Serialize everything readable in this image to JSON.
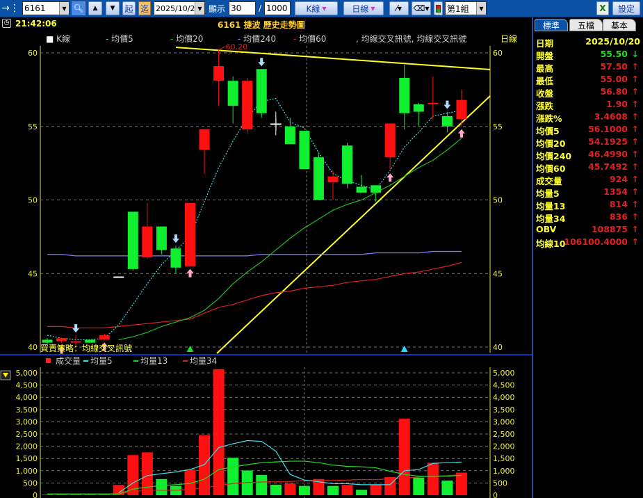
{
  "toolbar": {
    "symbol": "6161",
    "start_label": "起",
    "end_label": "迄",
    "date": "2025/10/20",
    "display_label": "顯示",
    "display_count": "30",
    "slash": "/",
    "total_count": "1000",
    "chart_type": "K線",
    "period": "日線",
    "group": "第1組",
    "settings_label": "設定"
  },
  "header": {
    "time": "21:42:06",
    "title": "6161 捷波  歷史走勢圖"
  },
  "legend": {
    "items": [
      {
        "label": "K線",
        "color": "#ffffff",
        "marker": "■"
      },
      {
        "label": "均價5",
        "color": "#44dddd",
        "marker": "-"
      },
      {
        "label": "均價20",
        "color": "#22cc22",
        "marker": "-"
      },
      {
        "label": "均價240",
        "color": "#8888ff",
        "marker": "-"
      },
      {
        "label": "均價60",
        "color": "#dd2222",
        "marker": "-"
      }
    ],
    "signal": ", 均線交叉訊號, 均線交叉訊號",
    "period": "日線"
  },
  "strategy_label": "買賣策略：均線交叉訊號",
  "high_marker": "60.20",
  "volume_legend": [
    {
      "label": "成交量",
      "color": "#ff2020",
      "marker": "■"
    },
    {
      "label": "均量5",
      "color": "#44ddee",
      "marker": "-"
    },
    {
      "label": "均量13",
      "color": "#22dd22",
      "marker": "-"
    },
    {
      "label": "均量34",
      "color": "#dd2222",
      "marker": "-"
    }
  ],
  "right_panel": {
    "tabs": [
      "標準",
      "五檔",
      "基本"
    ],
    "rows": [
      {
        "k": "日期",
        "v": "2025/10/20",
        "color": "#ffff33",
        "arrow": ""
      },
      {
        "k": "開盤",
        "v": "55.50",
        "color": "#22dd22",
        "arrow": "↓"
      },
      {
        "k": "最高",
        "v": "57.50",
        "color": "#e02020",
        "arrow": "↑"
      },
      {
        "k": "最低",
        "v": "55.00",
        "color": "#e02020",
        "arrow": "↑"
      },
      {
        "k": "收盤",
        "v": "56.80",
        "color": "#e02020",
        "arrow": "↑"
      },
      {
        "k": "漲跌",
        "v": "1.90",
        "color": "#e02020",
        "arrow": "↑"
      },
      {
        "k": "漲跌%",
        "v": "3.4608",
        "color": "#e02020",
        "arrow": "↑"
      },
      {
        "k": "均價5",
        "v": "56.1000",
        "color": "#e02020",
        "arrow": "↑"
      },
      {
        "k": "均價20",
        "v": "54.1925",
        "color": "#e02020",
        "arrow": "↑"
      },
      {
        "k": "均價240",
        "v": "46.4990",
        "color": "#e02020",
        "arrow": "↑"
      },
      {
        "k": "均價60",
        "v": "45.7492",
        "color": "#e02020",
        "arrow": "↑"
      },
      {
        "k": "成交量",
        "v": "924",
        "color": "#e02020",
        "arrow": "↑"
      },
      {
        "k": "均量5",
        "v": "1354",
        "color": "#e02020",
        "arrow": "↑"
      },
      {
        "k": "均量13",
        "v": "814",
        "color": "#e02020",
        "arrow": "↑"
      },
      {
        "k": "均量34",
        "v": "836",
        "color": "#e02020",
        "arrow": "↑"
      },
      {
        "k": "OBV",
        "v": "108875",
        "color": "#e02020",
        "arrow": "↑"
      },
      {
        "k": "均線10",
        "v": "106100.4000",
        "color": "#e02020",
        "arrow": "↑"
      }
    ]
  },
  "chart_data": [
    {
      "type": "candlestick",
      "price_ticks": [
        40,
        45,
        50,
        55,
        60
      ],
      "ylim": [
        39.6,
        60.4
      ],
      "ohlc": [
        [
          40.5,
          40.6,
          40.2,
          40.3
        ],
        [
          40.4,
          40.6,
          40.3,
          40.6
        ],
        [
          40.3,
          40.8,
          40.0,
          40.4
        ],
        [
          40.5,
          40.5,
          40.3,
          40.3
        ],
        [
          40.5,
          40.9,
          40.5,
          40.8
        ],
        [
          44.8,
          44.8,
          44.8,
          44.8
        ],
        [
          49.2,
          49.2,
          45.2,
          45.3
        ],
        [
          46.1,
          49.8,
          46.0,
          48.2
        ],
        [
          48.2,
          48.2,
          46.3,
          46.6
        ],
        [
          46.7,
          46.9,
          45.0,
          45.4
        ],
        [
          45.5,
          49.8,
          45.5,
          49.8
        ],
        [
          53.4,
          54.8,
          51.8,
          54.8
        ],
        [
          58.1,
          60.2,
          56.4,
          59.1
        ],
        [
          58.1,
          58.4,
          55.2,
          56.4
        ],
        [
          54.8,
          58.3,
          54.5,
          58.1
        ],
        [
          58.9,
          58.9,
          55.6,
          55.9
        ],
        [
          55.2,
          56.0,
          54.4,
          55.2
        ],
        [
          55.0,
          55.6,
          53.8,
          53.8
        ],
        [
          54.7,
          54.7,
          52.1,
          52.1
        ],
        [
          52.9,
          53.1,
          50.0,
          50.0
        ],
        [
          51.2,
          52.0,
          50.0,
          51.6
        ],
        [
          53.7,
          53.9,
          50.8,
          51.1
        ],
        [
          50.9,
          51.7,
          50.5,
          50.5
        ],
        [
          51.0,
          51.0,
          49.9,
          50.5
        ],
        [
          52.9,
          55.2,
          52.0,
          55.2
        ],
        [
          58.3,
          59.2,
          54.8,
          55.9
        ],
        [
          56.5,
          56.6,
          55.0,
          56.0
        ],
        [
          56.6,
          58.4,
          55.5,
          56.6
        ],
        [
          55.7,
          56.0,
          54.6,
          55.0
        ],
        [
          55.5,
          57.5,
          55.0,
          56.8
        ]
      ],
      "ma5": [
        40.8,
        40.6,
        40.5,
        40.5,
        40.6,
        41.5,
        42.9,
        44.3,
        45.6,
        46.6,
        47.5,
        49.9,
        52.2,
        54.0,
        55.6,
        56.7,
        56.9,
        55.3,
        54.9,
        53.2,
        51.8,
        51.3,
        51.0,
        50.7,
        52.0,
        53.6,
        54.6,
        55.7,
        55.9,
        56.1
      ],
      "ma20": [
        null,
        null,
        null,
        null,
        null,
        40.5,
        40.7,
        41.0,
        41.4,
        41.7,
        42.0,
        42.5,
        43.3,
        44.3,
        45.1,
        45.8,
        46.6,
        47.4,
        48.1,
        48.7,
        49.3,
        49.7,
        50.0,
        50.5,
        51.0,
        51.6,
        52.2,
        52.7,
        53.4,
        54.2
      ],
      "ma240": [
        46.3,
        46.3,
        46.2,
        46.2,
        46.2,
        46.2,
        46.2,
        46.2,
        46.2,
        46.2,
        46.2,
        46.2,
        46.2,
        46.2,
        46.2,
        46.3,
        46.3,
        46.3,
        46.3,
        46.3,
        46.3,
        46.3,
        46.3,
        46.4,
        46.4,
        46.4,
        46.4,
        46.5,
        46.5,
        46.5
      ],
      "ma60": [
        41.4,
        41.4,
        41.3,
        41.3,
        41.3,
        41.4,
        41.5,
        41.6,
        41.7,
        41.8,
        41.9,
        42.3,
        42.7,
        42.9,
        43.2,
        43.5,
        43.7,
        43.8,
        44.0,
        44.1,
        44.2,
        44.4,
        44.5,
        44.6,
        44.8,
        45.0,
        45.1,
        45.3,
        45.5,
        45.75
      ],
      "buy_signals": [
        1,
        4,
        10,
        24,
        29
      ],
      "sell_signals": [
        2,
        9,
        15,
        28
      ],
      "up_triangles": [
        {
          "i": 10,
          "color": "#22dd22"
        },
        {
          "i": 25,
          "color": "#22ddff"
        }
      ]
    },
    {
      "type": "bar",
      "title": "成交量",
      "volume_ticks": [
        0,
        500,
        1000,
        1500,
        2000,
        2500,
        3000,
        3500,
        4000,
        4500,
        5000
      ],
      "ylim": [
        0,
        5200
      ],
      "volume": [
        30,
        30,
        30,
        30,
        30,
        420,
        1640,
        1750,
        660,
        380,
        1050,
        2450,
        5150,
        1530,
        1010,
        830,
        430,
        480,
        380,
        660,
        380,
        420,
        220,
        420,
        740,
        3130,
        720,
        1330,
        600,
        924
      ],
      "volume_up": [
        1,
        1,
        1,
        1,
        1,
        1,
        1,
        1,
        0,
        0,
        1,
        1,
        1,
        0,
        0,
        0,
        0,
        1,
        0,
        1,
        0,
        1,
        0,
        1,
        1,
        1,
        0,
        1,
        0,
        1
      ],
      "vma5": [
        null,
        null,
        null,
        null,
        null,
        100,
        500,
        800,
        880,
        950,
        1050,
        1250,
        1950,
        2100,
        2230,
        2200,
        1800,
        850,
        620,
        550,
        470,
        470,
        430,
        430,
        430,
        1000,
        1050,
        1300,
        1330,
        1354
      ],
      "vma13": [
        50,
        50,
        50,
        50,
        50,
        50,
        250,
        330,
        400,
        430,
        480,
        650,
        1050,
        1150,
        1250,
        1330,
        1360,
        1390,
        1390,
        1330,
        1230,
        1180,
        1160,
        1120,
        980,
        850,
        780,
        760,
        780,
        814
      ],
      "vma34": [
        50,
        50,
        50,
        50,
        50,
        50,
        150,
        200,
        200,
        200,
        250,
        300,
        400,
        480,
        520,
        540,
        560,
        560,
        600,
        600,
        600,
        620,
        640,
        640,
        660,
        700,
        750,
        780,
        800,
        836
      ]
    }
  ]
}
